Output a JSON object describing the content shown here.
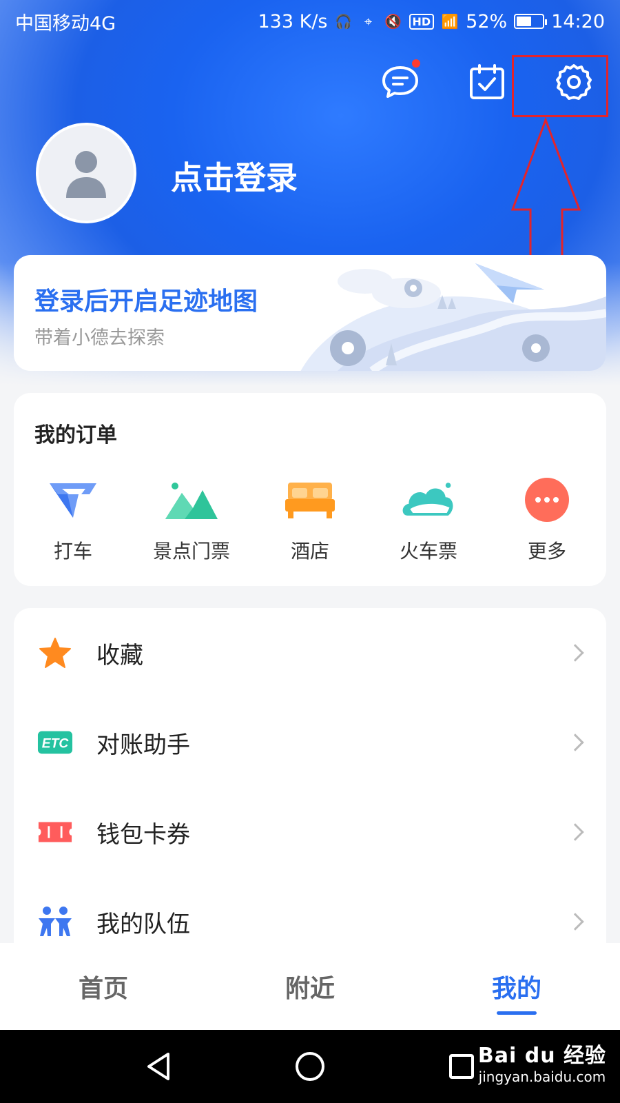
{
  "status_bar": {
    "carrier": "中国移动4G",
    "speed": "133 K/s",
    "hd_label": "HD",
    "battery": "52%",
    "time": "14:20"
  },
  "header": {
    "login_text": "点击登录"
  },
  "footprint": {
    "title": "登录后开启足迹地图",
    "subtitle": "带着小德去探索"
  },
  "orders": {
    "title": "我的订单",
    "items": [
      {
        "label": "打车",
        "icon": "taxi-icon"
      },
      {
        "label": "景点门票",
        "icon": "scenic-ticket-icon"
      },
      {
        "label": "酒店",
        "icon": "hotel-icon"
      },
      {
        "label": "火车票",
        "icon": "train-ticket-icon"
      },
      {
        "label": "更多",
        "icon": "more-icon"
      }
    ]
  },
  "menu": {
    "items": [
      {
        "label": "收藏",
        "icon": "star-icon"
      },
      {
        "label": "对账助手",
        "icon": "etc-icon"
      },
      {
        "label": "钱包卡券",
        "icon": "coupon-icon"
      },
      {
        "label": "我的队伍",
        "icon": "team-icon"
      }
    ]
  },
  "tabbar": {
    "tabs": [
      {
        "label": "首页"
      },
      {
        "label": "附近"
      },
      {
        "label": "我的"
      }
    ]
  },
  "watermark": {
    "main": "Bai du 经验",
    "sub": "jingyan.baidu.com"
  },
  "colors": {
    "accent": "#2a6ff0",
    "annotation": "#e3242b"
  }
}
